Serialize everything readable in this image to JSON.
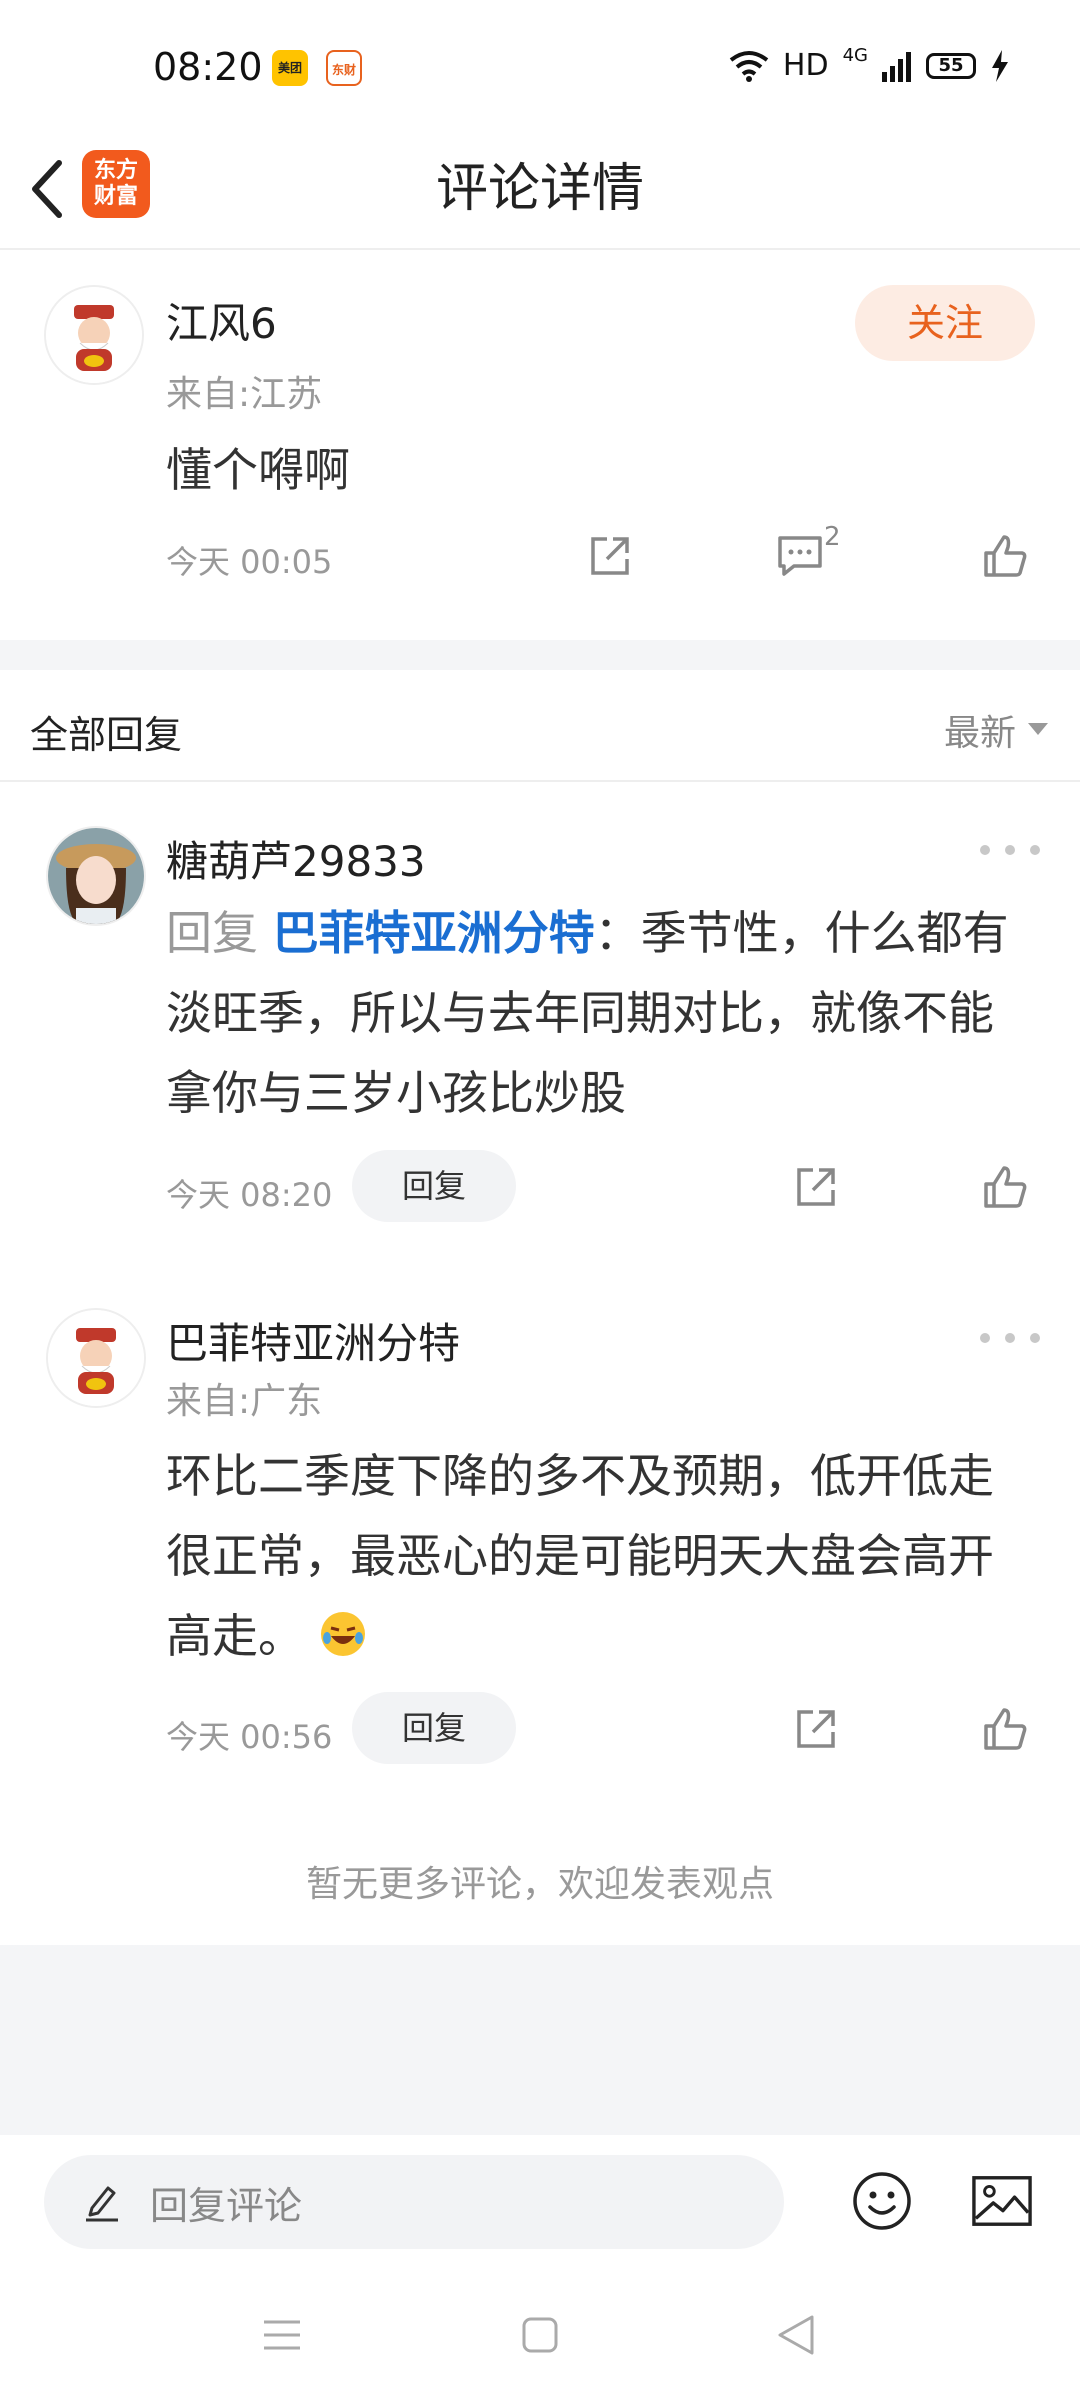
{
  "status_bar": {
    "time": "08:20",
    "app_icon_1": "美团",
    "app_icon_2": "东财",
    "network": "HD",
    "signal": "4G",
    "battery": "55"
  },
  "header": {
    "logo_line1": "东方",
    "logo_line2": "财富",
    "title": "评论详情"
  },
  "main_comment": {
    "username": "江风6",
    "location": "来自:江苏",
    "content": "懂个嘚啊",
    "time": "今天 00:05",
    "follow_label": "关注",
    "comment_count": "2"
  },
  "replies_section": {
    "title": "全部回复",
    "sort_label": "最新"
  },
  "replies": [
    {
      "username": "糖葫芦29833",
      "reply_prefix": "回复",
      "reply_target": "巴菲特亚洲分特",
      "content": "：季节性，什么都有淡旺季，所以与去年同期对比，就像不能拿你与三岁小孩比炒股",
      "time": "今天 08:20",
      "reply_label": "回复"
    },
    {
      "username": "巴菲特亚洲分特",
      "location": "来自:广东",
      "content": "环比二季度下降的多不及预期，低开低走很正常，最恶心的是可能明天大盘会高开高走。",
      "time": "今天 00:56",
      "reply_label": "回复"
    }
  ],
  "footer_note": "暂无更多评论，欢迎发表观点",
  "bottom_bar": {
    "placeholder": "回复评论"
  },
  "colors": {
    "accent_orange": "#e8621e",
    "link_blue": "#1a6ed2",
    "follow_bg": "#fdece3"
  }
}
